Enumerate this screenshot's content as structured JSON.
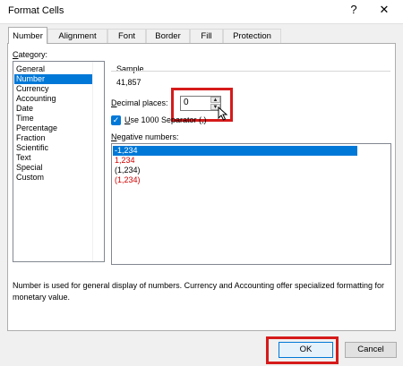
{
  "window": {
    "title": "Format Cells",
    "help_glyph": "?",
    "close_glyph": "✕"
  },
  "tabs": [
    {
      "label": "Number",
      "active": true
    },
    {
      "label": "Alignment"
    },
    {
      "label": "Font"
    },
    {
      "label": "Border"
    },
    {
      "label": "Fill"
    },
    {
      "label": "Protection"
    }
  ],
  "category": {
    "label_u": "C",
    "label_rest": "ategory:",
    "items": [
      "General",
      "Number",
      "Currency",
      "Accounting",
      "Date",
      "Time",
      "Percentage",
      "Fraction",
      "Scientific",
      "Text",
      "Special",
      "Custom"
    ],
    "selected": "Number"
  },
  "sample": {
    "label": "Sample",
    "value": "41,857"
  },
  "decimal_places": {
    "label_u": "D",
    "label_rest": "ecimal places:",
    "value": "0"
  },
  "separator": {
    "checked": true,
    "label_u": "U",
    "label_rest": "se 1000 Separator (,)"
  },
  "negative_numbers": {
    "label_u": "N",
    "label_rest": "egative numbers:",
    "items": [
      {
        "text": "-1,234",
        "color": "#ffffff",
        "selected": true
      },
      {
        "text": "1,234",
        "color": "#d00000"
      },
      {
        "text": "(1,234)",
        "color": "#000000"
      },
      {
        "text": "(1,234)",
        "color": "#d00000"
      }
    ]
  },
  "description": "Number is used for general display of numbers.  Currency and Accounting offer specialized formatting for monetary value.",
  "buttons": {
    "ok": "OK",
    "cancel": "Cancel"
  },
  "colors": {
    "accent": "#0078d7",
    "highlight": "#d61a1a",
    "negative_red": "#d00000"
  }
}
